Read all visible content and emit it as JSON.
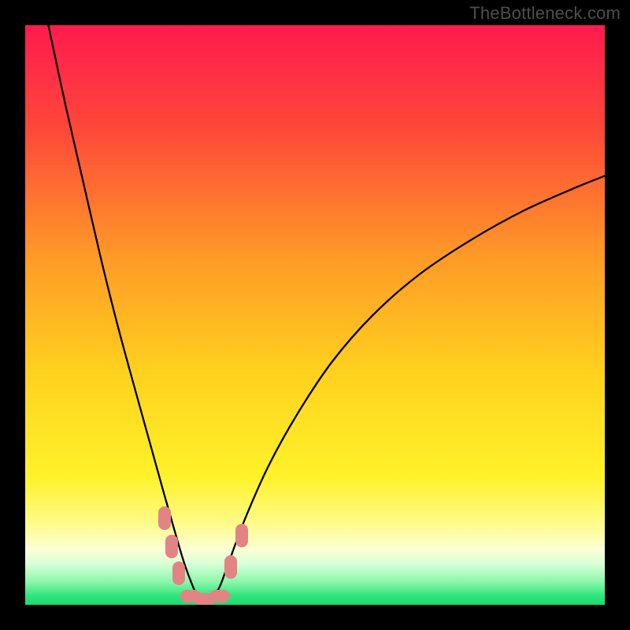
{
  "watermark": "TheBottleneck.com",
  "chart_data": {
    "type": "line",
    "title": "",
    "xlabel": "",
    "ylabel": "",
    "xlim": [
      0,
      100
    ],
    "ylim": [
      0,
      100
    ],
    "grid": false,
    "legend": false,
    "background_gradient": {
      "stops": [
        {
          "pos": 0.0,
          "color": "#ff1a4f"
        },
        {
          "pos": 0.18,
          "color": "#ff4839"
        },
        {
          "pos": 0.4,
          "color": "#ff9a27"
        },
        {
          "pos": 0.6,
          "color": "#ffd11e"
        },
        {
          "pos": 0.78,
          "color": "#fff22a"
        },
        {
          "pos": 0.86,
          "color": "#fffb8a"
        },
        {
          "pos": 0.905,
          "color": "#fbffd6"
        },
        {
          "pos": 0.93,
          "color": "#d7ffd7"
        },
        {
          "pos": 0.96,
          "color": "#8cf7ab"
        },
        {
          "pos": 0.985,
          "color": "#2ee57a"
        },
        {
          "pos": 1.0,
          "color": "#19db72"
        }
      ]
    },
    "series": [
      {
        "name": "bottleneck-curve",
        "x": [
          4.0,
          7.0,
          10.0,
          13.0,
          16.0,
          19.0,
          21.5,
          24.0,
          26.0,
          27.5,
          29.0,
          30.0,
          31.0,
          32.0,
          33.5,
          35.0,
          38.0,
          42.0,
          47.0,
          53.0,
          60.0,
          68.0,
          77.0,
          86.0,
          95.0,
          100.0
        ],
        "y": [
          100.0,
          86.0,
          73.0,
          60.0,
          48.0,
          37.0,
          28.0,
          19.0,
          12.0,
          7.0,
          3.0,
          1.0,
          0.5,
          1.0,
          3.0,
          7.0,
          15.0,
          24.0,
          33.0,
          42.0,
          50.0,
          57.0,
          63.0,
          68.0,
          72.0,
          74.0
        ]
      }
    ],
    "markers": [
      {
        "x": 24.0,
        "y": 15.0,
        "shape": "capsule-v"
      },
      {
        "x": 25.3,
        "y": 10.0,
        "shape": "capsule-v"
      },
      {
        "x": 26.5,
        "y": 5.5,
        "shape": "capsule-v"
      },
      {
        "x": 28.5,
        "y": 1.5,
        "shape": "capsule-h"
      },
      {
        "x": 31.0,
        "y": 1.0,
        "shape": "capsule-h"
      },
      {
        "x": 33.5,
        "y": 1.5,
        "shape": "capsule-h"
      },
      {
        "x": 35.5,
        "y": 6.5,
        "shape": "capsule-v"
      },
      {
        "x": 37.3,
        "y": 12.0,
        "shape": "capsule-v"
      }
    ],
    "colors": {
      "curve": "#000000",
      "marker": "#e38484",
      "frame": "#000000",
      "watermark": "#4d4d4d"
    }
  }
}
